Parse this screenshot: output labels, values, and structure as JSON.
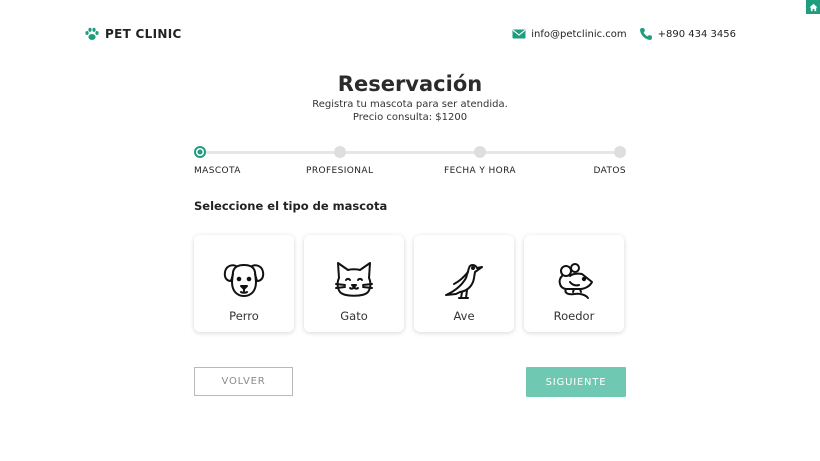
{
  "brand": {
    "name": "PET CLINIC",
    "accent": "#1f9d7f"
  },
  "contact": {
    "email": "info@petclinic.com",
    "phone": "+890 434 3456"
  },
  "page": {
    "title": "Reservación",
    "subtitle_line1": "Registra tu mascota para ser atendida.",
    "subtitle_line2": "Precio consulta: $1200"
  },
  "stepper": {
    "active_index": 0,
    "steps": [
      {
        "label": "MASCOTA"
      },
      {
        "label": "PROFESIONAL"
      },
      {
        "label": "FECHA Y HORA"
      },
      {
        "label": "DATOS"
      }
    ]
  },
  "pet_selection": {
    "heading": "Seleccione el tipo de mascota",
    "options": [
      {
        "label": "Perro",
        "icon": "dog-icon"
      },
      {
        "label": "Gato",
        "icon": "cat-icon"
      },
      {
        "label": "Ave",
        "icon": "bird-icon"
      },
      {
        "label": "Roedor",
        "icon": "rodent-icon"
      }
    ]
  },
  "actions": {
    "back_label": "VOLVER",
    "next_label": "SIGUIENTE",
    "next_color": "#6fc8b1"
  }
}
